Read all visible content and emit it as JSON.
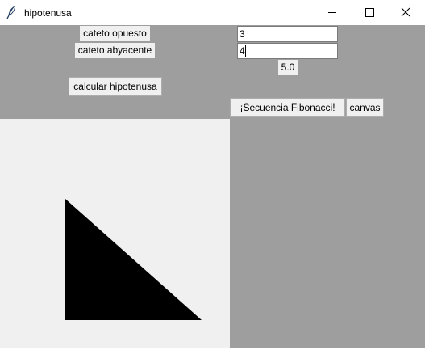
{
  "window": {
    "title": "hipotenusa",
    "icon": "feather-icon",
    "controls": [
      "minimize-icon",
      "maximize-icon",
      "close-icon"
    ]
  },
  "form": {
    "opposite_label": "cateto opuesto",
    "opposite_value": "3",
    "adjacent_label": "cateto abyacente",
    "adjacent_value": "4",
    "result": "5.0",
    "calculate_button": "calcular hipotenusa",
    "fibonacci_button": "¡Secuencia Fibonacci!",
    "canvas_button": "canvas"
  },
  "colors": {
    "window_background": "#9e9e9e",
    "widget_background": "#f0f0f0",
    "triangle_fill": "#000000"
  }
}
